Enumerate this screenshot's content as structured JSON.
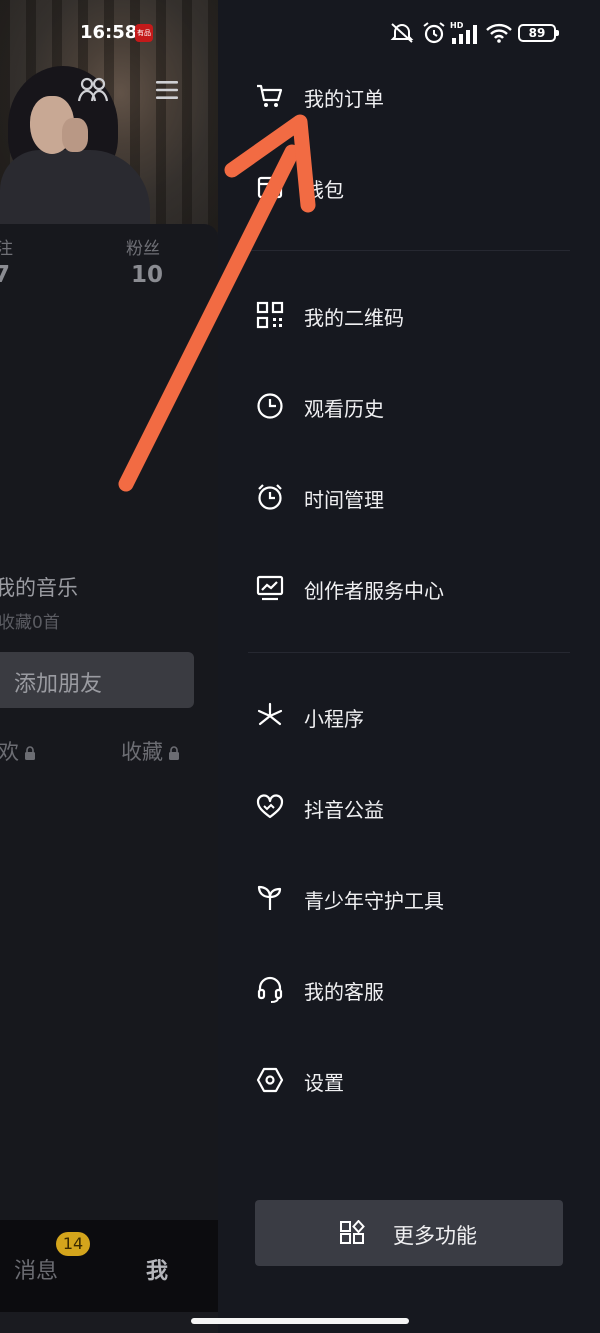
{
  "status_bar": {
    "time": "16:58",
    "app_badge": "有品",
    "battery": "89",
    "icons": [
      "mute-icon",
      "alarm-icon",
      "hd-signal-icon",
      "wifi-icon",
      "battery-icon"
    ]
  },
  "profile_bg": {
    "following_label": "注",
    "following_count": "7",
    "fans_label": "粉丝",
    "fans_count": "10",
    "music_title": "我的音乐",
    "music_sub": "收藏0首",
    "add_friend": "添加朋友",
    "tab_likes": "欢",
    "tab_favorites": "收藏"
  },
  "bottom_tabs": {
    "messages": "消息",
    "messages_badge": "14",
    "me": "我"
  },
  "drawer": {
    "items": [
      {
        "label": "我的订单",
        "icon": "cart-icon"
      },
      {
        "label": "钱包",
        "icon": "wallet-icon"
      },
      {
        "label": "我的二维码",
        "icon": "qr-code-icon"
      },
      {
        "label": "观看历史",
        "icon": "clock-icon"
      },
      {
        "label": "时间管理",
        "icon": "alarm-clock-icon"
      },
      {
        "label": "创作者服务中心",
        "icon": "chart-icon"
      },
      {
        "label": "小程序",
        "icon": "mini-program-icon"
      },
      {
        "label": "抖音公益",
        "icon": "charity-heart-icon"
      },
      {
        "label": "青少年守护工具",
        "icon": "sprout-icon"
      },
      {
        "label": "我的客服",
        "icon": "headset-icon"
      },
      {
        "label": "设置",
        "icon": "settings-hexagon-icon"
      }
    ],
    "more_button": "更多功能"
  },
  "colors": {
    "drawer_bg": "#16181f",
    "annotation_arrow": "#f26b43",
    "badge": "#d4a51c"
  }
}
